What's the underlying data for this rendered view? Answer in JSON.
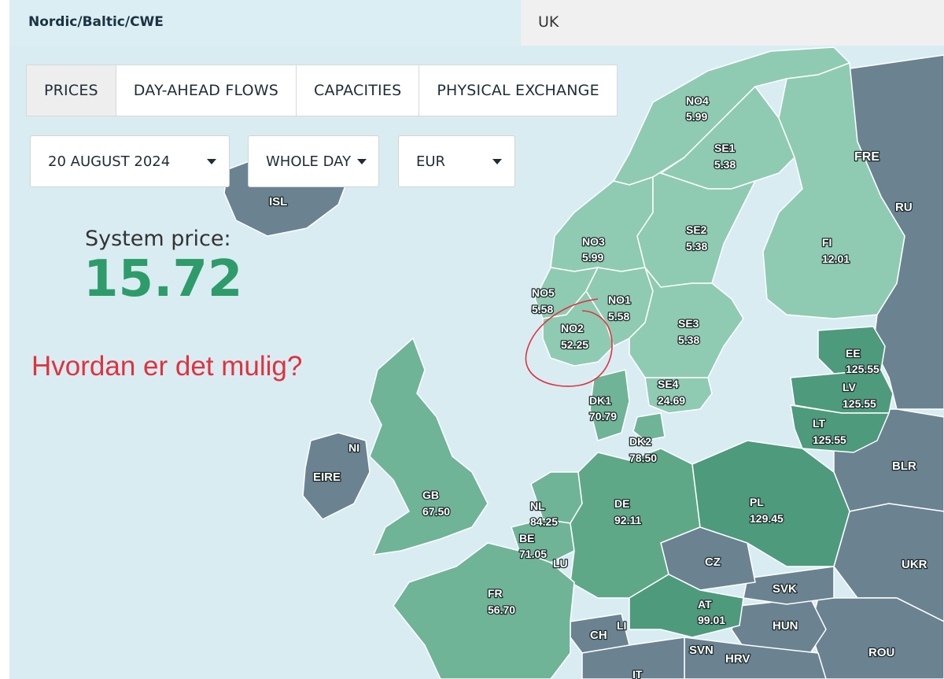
{
  "header": {
    "region_tab": "Nordic/Baltic/CWE",
    "uk_tab": "UK"
  },
  "tabs": [
    {
      "label": "PRICES",
      "active": true
    },
    {
      "label": "DAY-AHEAD FLOWS",
      "active": false
    },
    {
      "label": "CAPACITIES",
      "active": false
    },
    {
      "label": "PHYSICAL EXCHANGE",
      "active": false
    }
  ],
  "filters": {
    "date": "20 AUGUST 2024",
    "period": "WHOLE DAY",
    "currency": "EUR"
  },
  "system_price": {
    "label": "System price:",
    "value": "15.72"
  },
  "annotation": "Hvordan er det mulig?",
  "colors": {
    "price_zone": "#8fcbb2",
    "high_price": "#4e9a7c",
    "non_member": "#6b8291",
    "sea": "#d9ecf2",
    "accent": "#2e9b6a",
    "annotation": "#e0323f"
  },
  "zones": [
    {
      "code": "NO4",
      "price": "5.99"
    },
    {
      "code": "SE1",
      "price": "5.38"
    },
    {
      "code": "NO3",
      "price": "5.99"
    },
    {
      "code": "SE2",
      "price": "5.38"
    },
    {
      "code": "FI",
      "price": "12.01"
    },
    {
      "code": "NO5",
      "price": "5.58"
    },
    {
      "code": "NO1",
      "price": "5.58"
    },
    {
      "code": "NO2",
      "price": "52.25"
    },
    {
      "code": "SE3",
      "price": "5.38"
    },
    {
      "code": "EE",
      "price": "125.55"
    },
    {
      "code": "LV",
      "price": "125.55"
    },
    {
      "code": "LT",
      "price": "125.55"
    },
    {
      "code": "SE4",
      "price": "24.69"
    },
    {
      "code": "DK1",
      "price": "70.79"
    },
    {
      "code": "DK2",
      "price": "78.50"
    },
    {
      "code": "GB",
      "price": "67.50"
    },
    {
      "code": "NL",
      "price": "84.25"
    },
    {
      "code": "BE",
      "price": "71.05"
    },
    {
      "code": "DE",
      "price": "92.11"
    },
    {
      "code": "PL",
      "price": "129.45"
    },
    {
      "code": "FR",
      "price": "56.70"
    },
    {
      "code": "AT",
      "price": "99.01"
    }
  ],
  "other_countries": [
    "FRE",
    "RU",
    "ISL",
    "NI",
    "EIRE",
    "BLR",
    "UKR",
    "CZ",
    "SVK",
    "HUN",
    "LU",
    "CH",
    "LI",
    "SVN",
    "HRV",
    "ROU",
    "IT"
  ]
}
